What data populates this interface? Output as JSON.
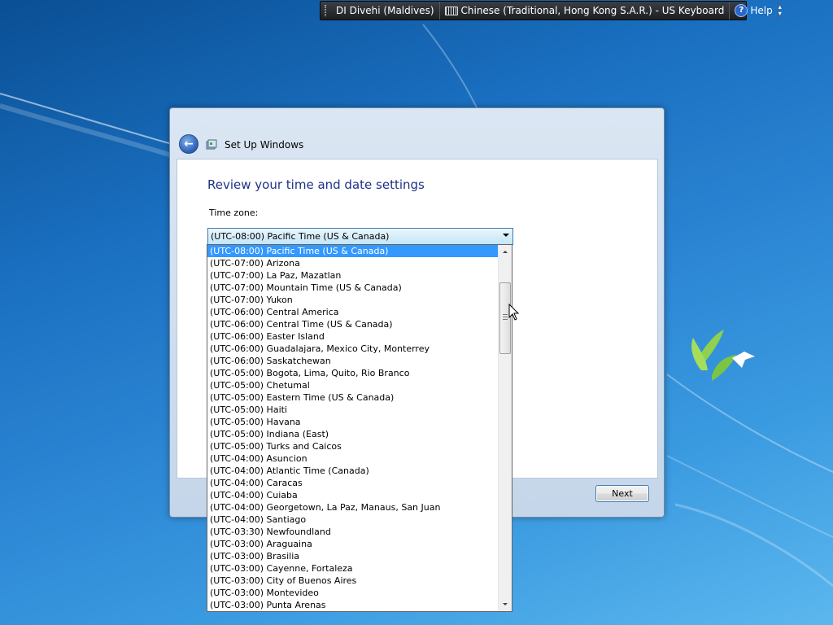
{
  "language_bar": {
    "input_language": "DI  Divehi (Maldives)",
    "keyboard": "Chinese (Traditional, Hong Kong S.A.R.) - US Keyboard",
    "help": "Help",
    "help_icon": "?"
  },
  "window": {
    "title": "Set Up Windows",
    "back_icon": "arrow-left",
    "heading": "Review your time and date settings",
    "timezone_label": "Time zone:",
    "timezone_selected": "(UTC-08:00) Pacific Time (US & Canada)",
    "next_label": "Next"
  },
  "dropdown": {
    "selected_index": 0,
    "options": [
      "(UTC-08:00) Pacific Time (US & Canada)",
      "(UTC-07:00) Arizona",
      "(UTC-07:00) La Paz, Mazatlan",
      "(UTC-07:00) Mountain Time (US & Canada)",
      "(UTC-07:00) Yukon",
      "(UTC-06:00) Central America",
      "(UTC-06:00) Central Time (US & Canada)",
      "(UTC-06:00) Easter Island",
      "(UTC-06:00) Guadalajara, Mexico City, Monterrey",
      "(UTC-06:00) Saskatchewan",
      "(UTC-05:00) Bogota, Lima, Quito, Rio Branco",
      "(UTC-05:00) Chetumal",
      "(UTC-05:00) Eastern Time (US & Canada)",
      "(UTC-05:00) Haiti",
      "(UTC-05:00) Havana",
      "(UTC-05:00) Indiana (East)",
      "(UTC-05:00) Turks and Caicos",
      "(UTC-04:00) Asuncion",
      "(UTC-04:00) Atlantic Time (Canada)",
      "(UTC-04:00) Caracas",
      "(UTC-04:00) Cuiaba",
      "(UTC-04:00) Georgetown, La Paz, Manaus, San Juan",
      "(UTC-04:00) Santiago",
      "(UTC-03:30) Newfoundland",
      "(UTC-03:00) Araguaina",
      "(UTC-03:00) Brasilia",
      "(UTC-03:00) Cayenne, Fortaleza",
      "(UTC-03:00) City of Buenos Aires",
      "(UTC-03:00) Montevideo",
      "(UTC-03:00) Punta Arenas"
    ]
  }
}
